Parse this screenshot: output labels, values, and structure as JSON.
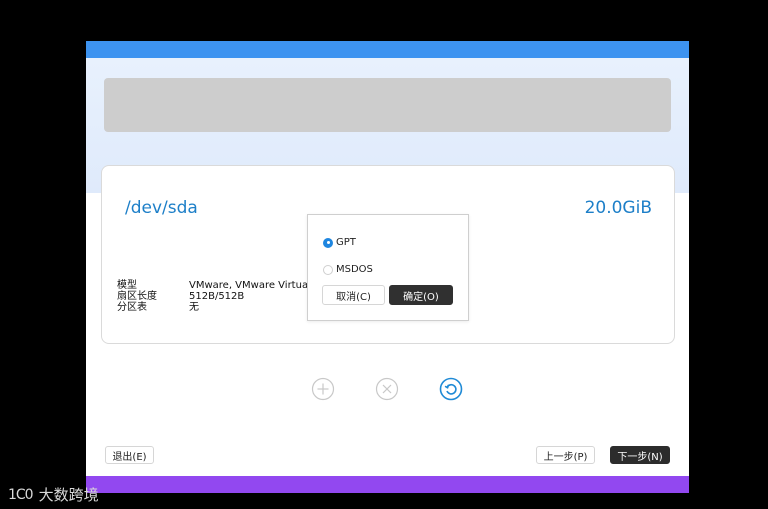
{
  "disk": {
    "name": "/dev/sda",
    "size": "20.0GiB",
    "labels": [
      "模型",
      "扇区长度",
      "分区表"
    ],
    "values": [
      "VMware, VMware Virtual",
      "512B/512B",
      "无"
    ]
  },
  "dialog": {
    "options": [
      {
        "label": "GPT",
        "selected": true
      },
      {
        "label": "MSDOS",
        "selected": false
      }
    ],
    "cancel_label": "取消(C)",
    "ok_label": "确定(O)"
  },
  "actions": {
    "icons": [
      "add-icon",
      "remove-icon",
      "revert-icon"
    ]
  },
  "footer": {
    "exit_label": "退出(E)",
    "prev_label": "上一步(P)",
    "next_label": "下一步(N)"
  },
  "colors": {
    "top_bar": "#3d93f0",
    "bottom_bar": "#9248f0",
    "accent_text": "#1d7fc8"
  },
  "watermark": {
    "logo": "1C0",
    "text": "大数跨境"
  }
}
